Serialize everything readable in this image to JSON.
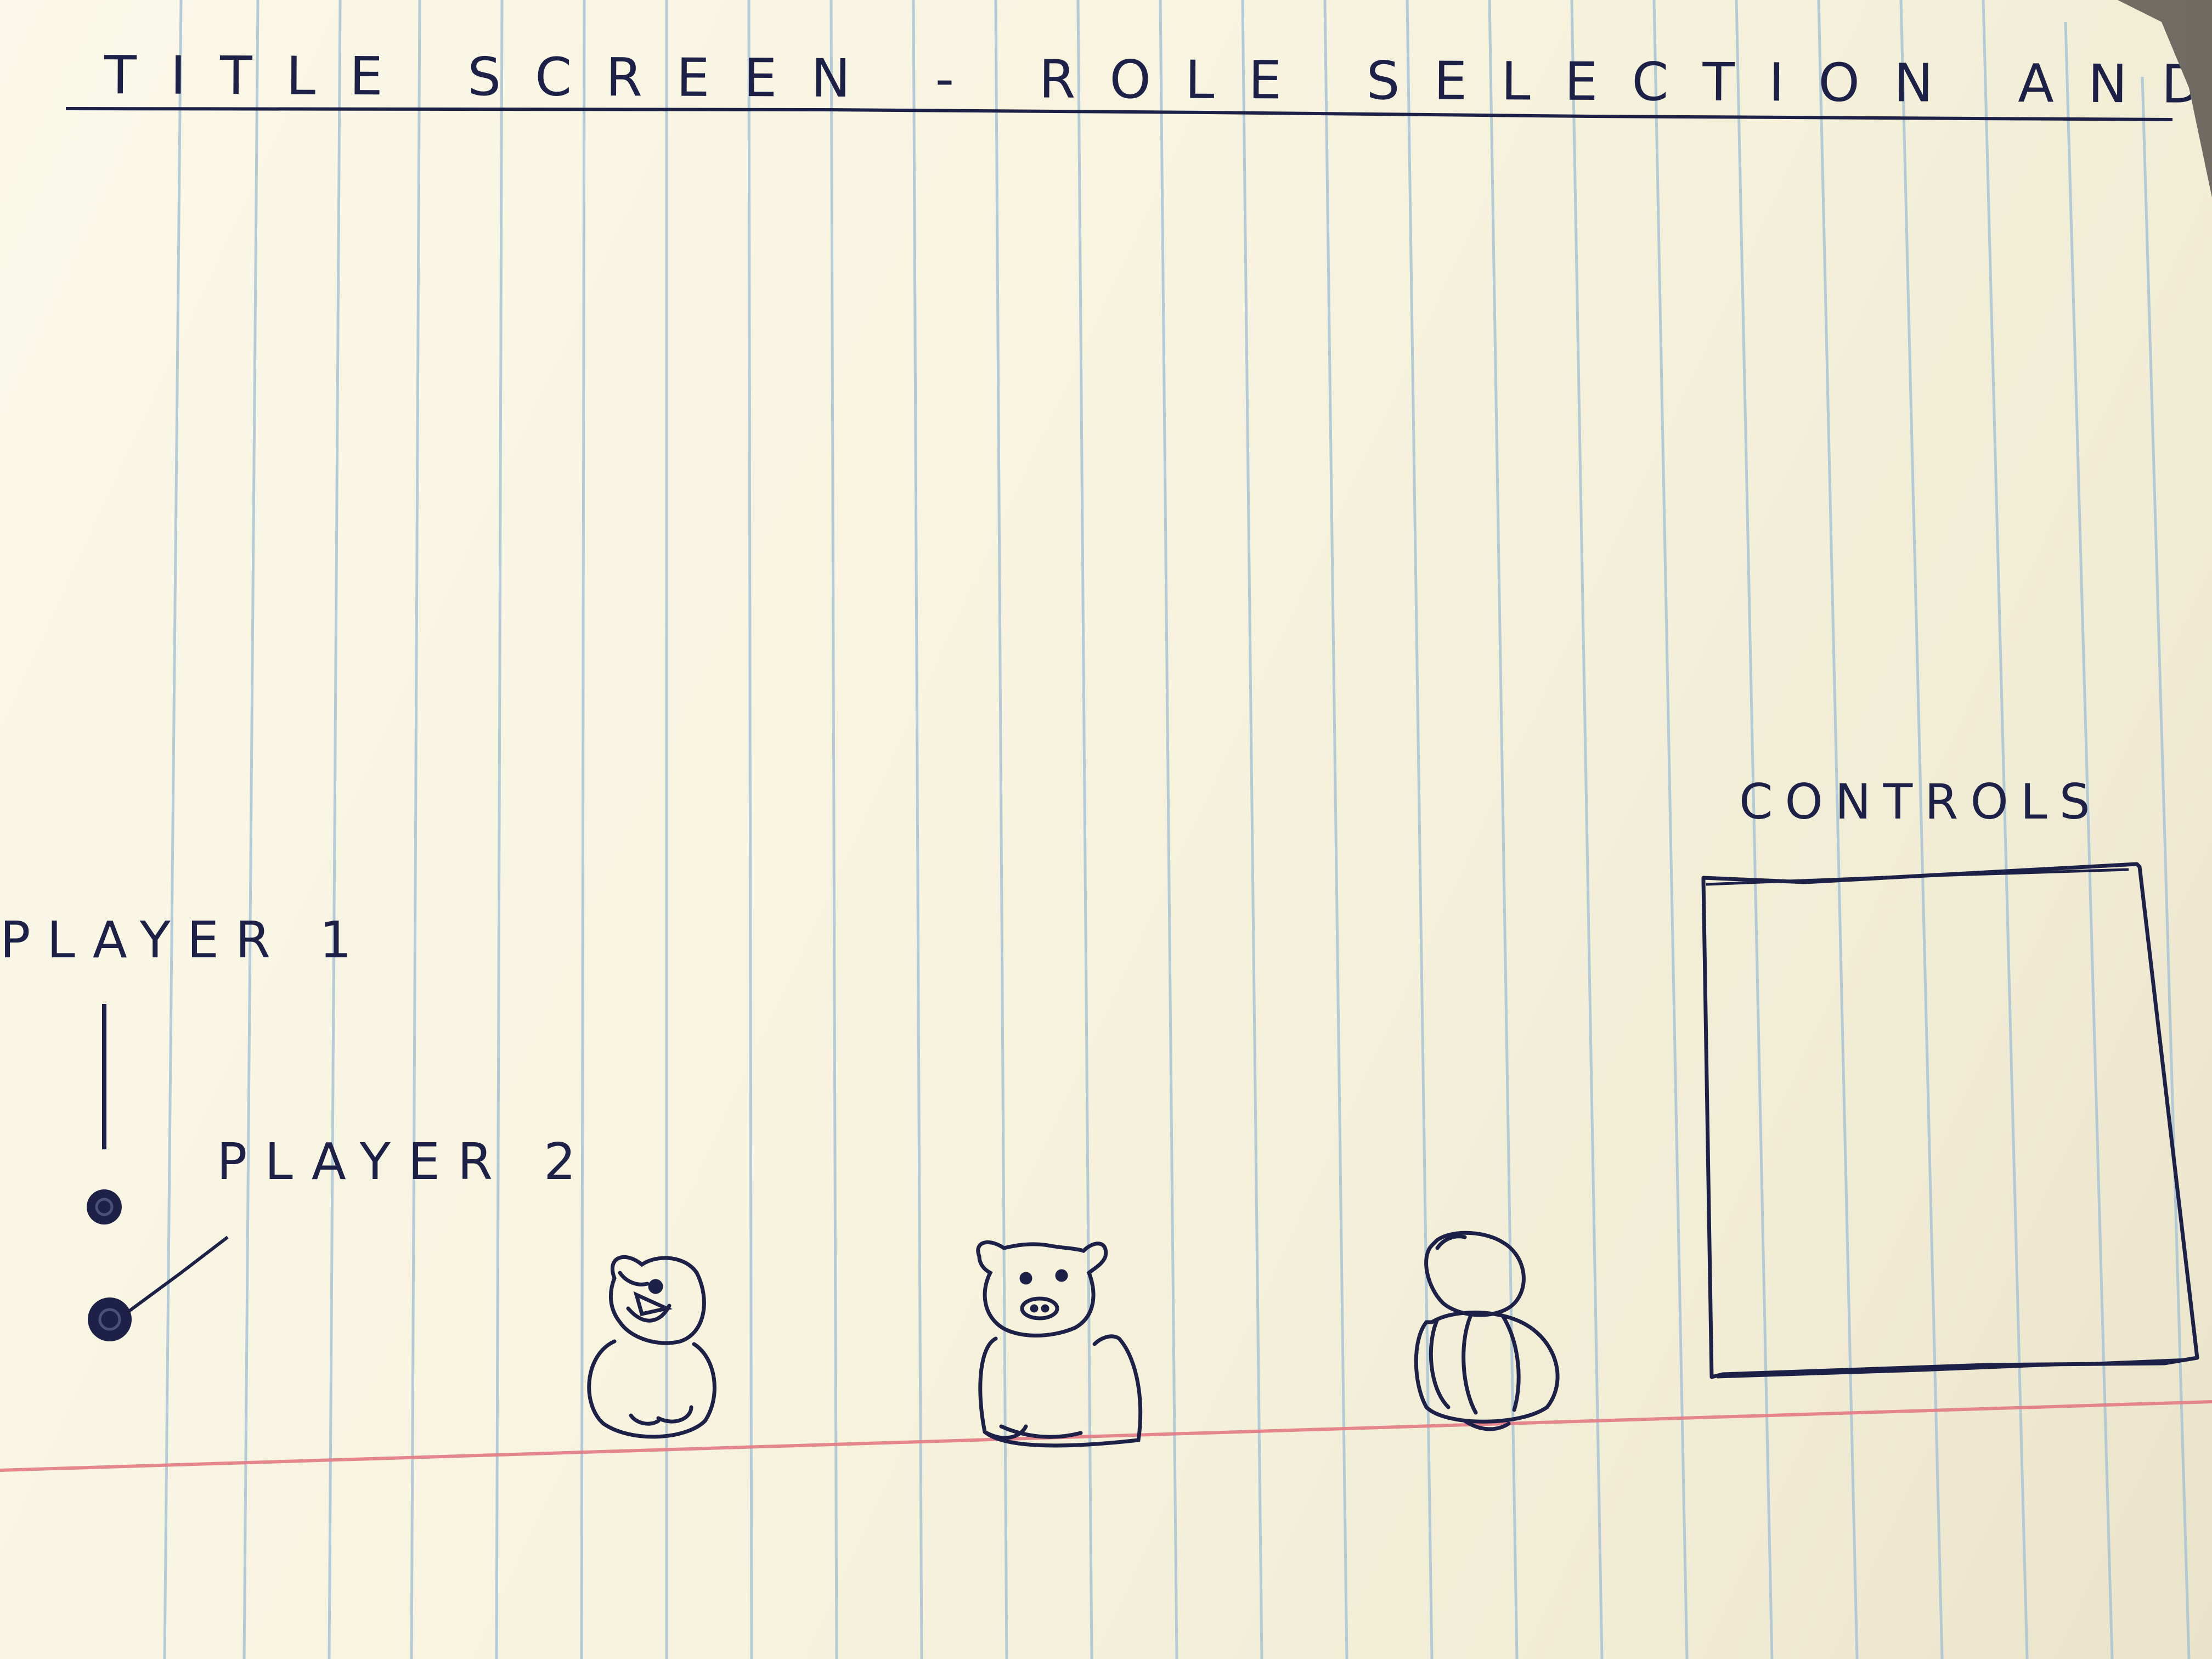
{
  "sketch": {
    "title": "TITLE SCREEN - ROLE SELECTION AND CONTROLS",
    "player_1_label": "PLAYER 1",
    "player_2_label": "PLAYER 2",
    "controls_label": "CONTROLS",
    "characters": [
      {
        "name": "bird"
      },
      {
        "name": "pig"
      },
      {
        "name": "snowman"
      }
    ]
  },
  "colors": {
    "ink": "#1d2147",
    "rule_line": "#9fbfd2",
    "margin_line": "#e2717a",
    "paper": "#f8f4e0"
  }
}
